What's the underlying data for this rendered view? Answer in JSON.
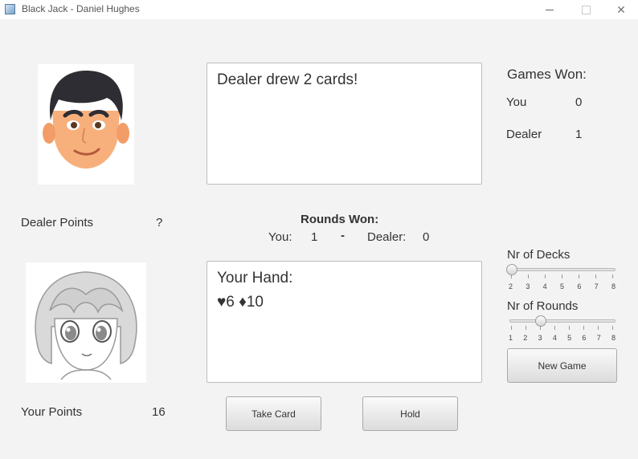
{
  "window": {
    "title": "Black Jack - Daniel Hughes",
    "minimize": "—",
    "maximize": "☐",
    "close": "✕"
  },
  "message": "Dealer drew 2 cards!",
  "dealer": {
    "label": "Dealer Points",
    "value": "?"
  },
  "player": {
    "label": "Your Points",
    "value": "16"
  },
  "hand": {
    "title": "Your Hand:",
    "cards": "♥6 ♦10"
  },
  "rounds": {
    "title": "Rounds Won:",
    "you_label": "You:",
    "you_value": "1",
    "dash": "-",
    "dealer_label": "Dealer:",
    "dealer_value": "0"
  },
  "games": {
    "title": "Games Won:",
    "you_label": "You",
    "you_value": "0",
    "dealer_label": "Dealer",
    "dealer_value": "1"
  },
  "decks": {
    "label": "Nr of Decks",
    "ticks": [
      "2",
      "3",
      "4",
      "5",
      "6",
      "7",
      "8"
    ],
    "value": 2
  },
  "rounds_setting": {
    "label": "Nr of Rounds",
    "ticks": [
      "1",
      "2",
      "3",
      "4",
      "5",
      "6",
      "7",
      "8"
    ],
    "value": 3
  },
  "buttons": {
    "new_game": "New Game",
    "take_card": "Take Card",
    "hold": "Hold"
  },
  "icons": {
    "app": "app-window-icon",
    "dealer_avatar": "dealer-face-avatar",
    "player_avatar": "anime-girl-avatar"
  }
}
